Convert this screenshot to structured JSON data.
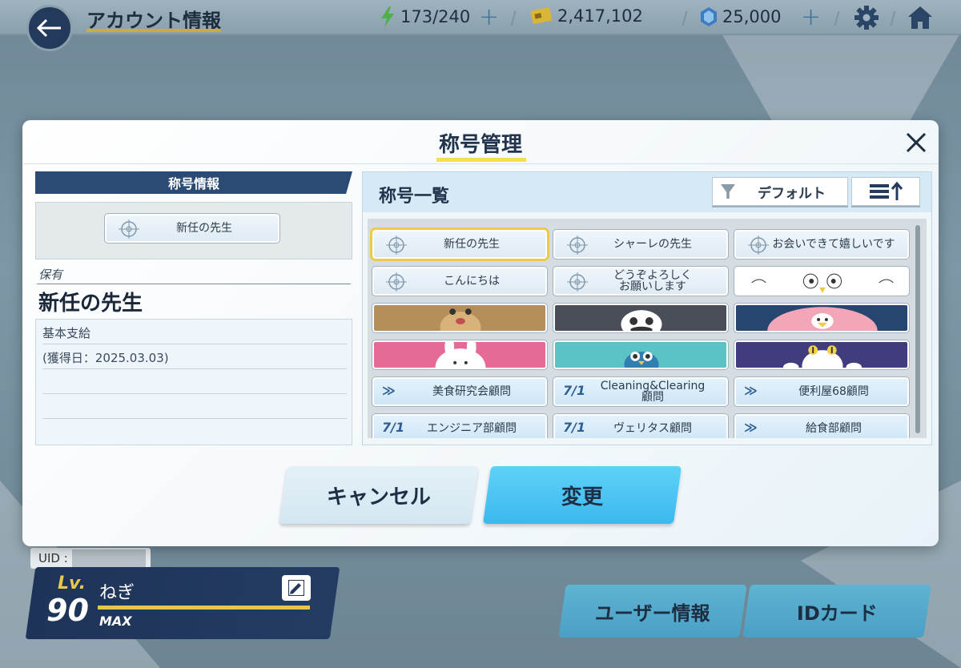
{
  "topbar": {
    "title": "アカウント情報",
    "ap": "173/240",
    "credits": "2,417,102",
    "gems": "25,000",
    "back_icon": "arrow-left-icon",
    "settings_icon": "gear-icon",
    "home_icon": "home-icon"
  },
  "dialog": {
    "title": "称号管理",
    "left": {
      "header": "称号情報",
      "preview_title": "新任の先生",
      "owned_label": "保有",
      "owned_name": "新任の先生",
      "desc_rows": [
        "基本支給",
        "(獲得日：2025.03.03)",
        "",
        ""
      ]
    },
    "right": {
      "header": "称号一覧",
      "sort_label": "デフォルト",
      "tiles": [
        {
          "text": "新任の先生",
          "style": "plain",
          "selected": true
        },
        {
          "text": "シャーレの先生",
          "style": "plain"
        },
        {
          "text": "お会いできて嬉しいです",
          "style": "plain"
        },
        {
          "text": "こんにちは",
          "style": "plain"
        },
        {
          "text": "どうぞよろしく\nお願いします",
          "style": "plain"
        },
        {
          "text": "",
          "style": "bird"
        },
        {
          "text": "",
          "style": "tan"
        },
        {
          "text": "",
          "style": "dark"
        },
        {
          "text": "",
          "style": "navy"
        },
        {
          "text": "",
          "style": "pink"
        },
        {
          "text": "",
          "style": "teal"
        },
        {
          "text": "",
          "style": "purple"
        },
        {
          "text": "美食研究会顧問",
          "style": "club",
          "logo": "≫"
        },
        {
          "text": "Cleaning&Clearing\n顧問",
          "style": "club",
          "logo": "7/1"
        },
        {
          "text": "便利屋68顧問",
          "style": "club",
          "logo": "≫"
        },
        {
          "text": "エンジニア部顧問",
          "style": "club",
          "logo": "7/1"
        },
        {
          "text": "ヴェリタス顧問",
          "style": "club",
          "logo": "7/1"
        },
        {
          "text": "給食部顧問",
          "style": "club",
          "logo": "≫"
        }
      ]
    },
    "buttons": {
      "cancel": "キャンセル",
      "change": "変更"
    },
    "close_icon": "close-icon"
  },
  "player": {
    "uid_label": "UID :",
    "lv_label": "Lv.",
    "level": "90",
    "name": "ねぎ",
    "max": "MAX"
  },
  "bottom_buttons": {
    "user_info": "ユーザー情報",
    "id_card": "IDカード"
  },
  "colors": {
    "accent": "#3cb8ef",
    "navy": "#2b4b74",
    "gold": "#f0c84a"
  }
}
